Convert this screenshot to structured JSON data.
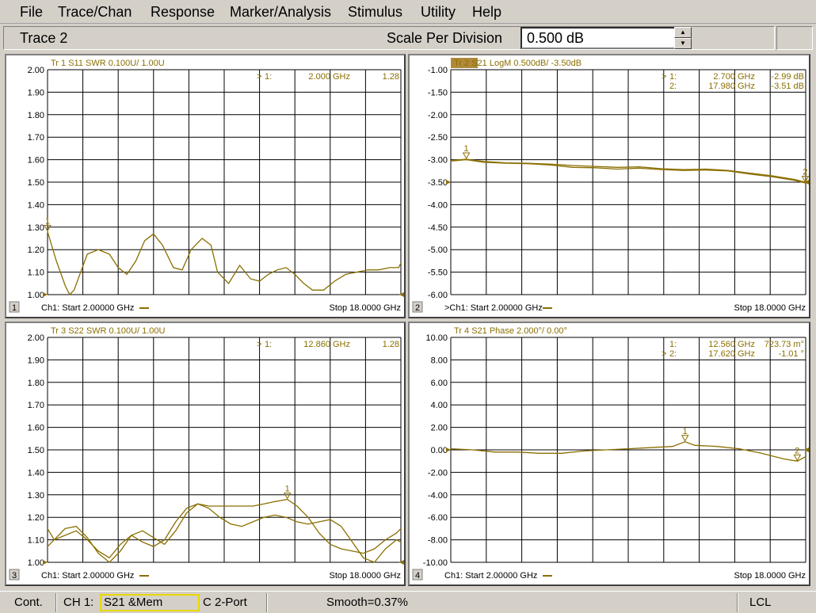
{
  "menu": [
    "File",
    "Trace/Chan",
    "Response",
    "Marker/Analysis",
    "Stimulus",
    "Utility",
    "Help"
  ],
  "entry": {
    "title": "Trace 2",
    "label": "Scale Per Division",
    "value": "0.500 dB"
  },
  "colors": {
    "trace": "#8a6f00",
    "grid": "#000000",
    "active_tab": "#b08a3a"
  },
  "panes": [
    {
      "window_number": "1",
      "header": "Tr  1  S11 SWR 0.100U/  1.00U",
      "active": false,
      "marker_table": [
        {
          "arrow": ">",
          "name": "1:",
          "stimulus": "2.000 GHz",
          "response": "1.28"
        }
      ],
      "footer_start": "Ch1: Start  2.00000 GHz",
      "footer_stop": "Stop  18.0000 GHz",
      "chart_data": {
        "type": "line",
        "xlim": [
          2,
          18
        ],
        "ylim": [
          1.0,
          2.0
        ],
        "yticks": [
          "2.00",
          "1.90",
          "1.80",
          "1.70",
          "1.60",
          "1.50",
          "1.40",
          "1.30",
          "1.20",
          "1.10",
          "1.00"
        ],
        "reference": 1.0,
        "series": [
          {
            "x": [
              2.0,
              2.4,
              2.8,
              3.0,
              3.2,
              3.5,
              3.8,
              4.3,
              4.8,
              5.2,
              5.6,
              6.0,
              6.4,
              6.8,
              7.2,
              7.7,
              8.1,
              8.5,
              9.0,
              9.4,
              9.7,
              10.2,
              10.7,
              11.2,
              11.6,
              12.0,
              12.4,
              12.8,
              13.2,
              13.6,
              14.0,
              14.5,
              15.0,
              15.5,
              16.0,
              16.5,
              17.0,
              17.5,
              17.9,
              18.0
            ],
            "y": [
              1.28,
              1.15,
              1.04,
              1.0,
              1.02,
              1.1,
              1.18,
              1.2,
              1.18,
              1.12,
              1.09,
              1.15,
              1.24,
              1.27,
              1.22,
              1.12,
              1.11,
              1.2,
              1.25,
              1.22,
              1.1,
              1.05,
              1.13,
              1.07,
              1.06,
              1.09,
              1.11,
              1.12,
              1.09,
              1.05,
              1.02,
              1.02,
              1.06,
              1.09,
              1.1,
              1.11,
              1.11,
              1.12,
              1.12,
              1.14
            ]
          }
        ],
        "markers": [
          {
            "label": "1",
            "x": 2.0,
            "y": 1.28
          }
        ]
      }
    },
    {
      "window_number": "2",
      "header": "Tr  2  S21 LogM 0.500dB/  -3.50dB",
      "active": true,
      "marker_table": [
        {
          "arrow": ">",
          "name": "1:",
          "stimulus": "2.700 GHz",
          "response": "-2.99 dB"
        },
        {
          "arrow": "",
          "name": "2:",
          "stimulus": "17.980 GHz",
          "response": "-3.51 dB"
        }
      ],
      "footer_start": ">Ch1: Start  2.00000 GHz",
      "footer_stop": "Stop  18.0000 GHz",
      "chart_data": {
        "type": "line",
        "xlim": [
          2,
          18
        ],
        "ylim": [
          -6.0,
          -1.0
        ],
        "yticks": [
          "-1.00",
          "-1.50",
          "-2.00",
          "-2.50",
          "-3.00",
          "-3.50",
          "-4.00",
          "-4.50",
          "-5.00",
          "-5.50",
          "-6.00"
        ],
        "reference": -3.5,
        "series": [
          {
            "name": "data",
            "x": [
              2.0,
              2.7,
              3.5,
              4.5,
              5.5,
              6.5,
              7.5,
              8.5,
              9.5,
              10.5,
              11.5,
              12.5,
              13.5,
              14.5,
              15.5,
              16.5,
              17.5,
              18.0
            ],
            "y": [
              -3.02,
              -2.99,
              -3.04,
              -3.07,
              -3.08,
              -3.1,
              -3.13,
              -3.15,
              -3.17,
              -3.16,
              -3.2,
              -3.22,
              -3.21,
              -3.24,
              -3.3,
              -3.36,
              -3.44,
              -3.5
            ]
          },
          {
            "name": "memory",
            "x": [
              2.0,
              2.7,
              3.5,
              4.5,
              5.5,
              6.5,
              7.5,
              8.5,
              9.5,
              10.5,
              11.5,
              12.5,
              13.5,
              14.5,
              15.5,
              16.5,
              17.5,
              18.0
            ],
            "y": [
              -3.03,
              -3.0,
              -3.06,
              -3.08,
              -3.09,
              -3.12,
              -3.17,
              -3.18,
              -3.21,
              -3.19,
              -3.22,
              -3.24,
              -3.23,
              -3.25,
              -3.32,
              -3.38,
              -3.46,
              -3.52
            ]
          }
        ],
        "markers": [
          {
            "label": "1",
            "x": 2.7,
            "y": -2.99
          },
          {
            "label": "2",
            "x": 17.98,
            "y": -3.51
          }
        ]
      }
    },
    {
      "window_number": "3",
      "header": "Tr  3  S22 SWR 0.100U/  1.00U",
      "active": false,
      "marker_table": [
        {
          "arrow": ">",
          "name": "1:",
          "stimulus": "12.860 GHz",
          "response": "1.28"
        }
      ],
      "footer_start": "Ch1: Start  2.00000 GHz",
      "footer_stop": "Stop  18.0000 GHz",
      "chart_data": {
        "type": "line",
        "xlim": [
          2,
          18
        ],
        "ylim": [
          1.0,
          2.0
        ],
        "yticks": [
          "2.00",
          "1.90",
          "1.80",
          "1.70",
          "1.60",
          "1.50",
          "1.40",
          "1.30",
          "1.20",
          "1.10",
          "1.00"
        ],
        "reference": 1.0,
        "series": [
          {
            "name": "data",
            "x": [
              2.0,
              2.3,
              2.8,
              3.3,
              3.8,
              4.3,
              4.8,
              5.3,
              5.8,
              6.3,
              6.8,
              7.3,
              7.8,
              8.3,
              8.8,
              9.3,
              9.8,
              10.3,
              10.8,
              11.3,
              11.8,
              12.3,
              12.86,
              13.3,
              13.8,
              14.3,
              14.8,
              15.3,
              15.8,
              16.3,
              16.8,
              17.3,
              17.8,
              18.0
            ],
            "y": [
              1.15,
              1.1,
              1.12,
              1.14,
              1.1,
              1.05,
              1.02,
              1.08,
              1.12,
              1.09,
              1.07,
              1.1,
              1.18,
              1.24,
              1.26,
              1.25,
              1.25,
              1.25,
              1.25,
              1.25,
              1.26,
              1.27,
              1.28,
              1.25,
              1.2,
              1.13,
              1.08,
              1.06,
              1.05,
              1.04,
              1.06,
              1.1,
              1.13,
              1.15
            ]
          },
          {
            "name": "memory",
            "x": [
              2.0,
              2.3,
              2.8,
              3.3,
              3.8,
              4.3,
              4.8,
              5.3,
              5.8,
              6.3,
              6.8,
              7.3,
              7.8,
              8.3,
              8.8,
              9.3,
              9.8,
              10.3,
              10.8,
              11.3,
              11.8,
              12.3,
              12.8,
              13.3,
              13.8,
              14.3,
              14.8,
              15.3,
              15.8,
              16.3,
              16.8,
              17.3,
              17.8,
              18.0
            ],
            "y": [
              1.07,
              1.1,
              1.15,
              1.16,
              1.11,
              1.04,
              1.0,
              1.05,
              1.12,
              1.14,
              1.11,
              1.08,
              1.14,
              1.22,
              1.26,
              1.24,
              1.2,
              1.17,
              1.16,
              1.18,
              1.2,
              1.21,
              1.2,
              1.18,
              1.17,
              1.18,
              1.19,
              1.16,
              1.09,
              1.02,
              1.0,
              1.06,
              1.1,
              1.09
            ]
          }
        ],
        "markers": [
          {
            "label": "1",
            "x": 12.86,
            "y": 1.28
          }
        ]
      }
    },
    {
      "window_number": "4",
      "header": "Tr  4  S21 Phase 2.000°/  0.00°",
      "active": false,
      "marker_table": [
        {
          "arrow": "",
          "name": "1:",
          "stimulus": "12.560 GHz",
          "response": "723.73 m°"
        },
        {
          "arrow": ">",
          "name": "2:",
          "stimulus": "17.620 GHz",
          "response": "-1.01 °"
        }
      ],
      "footer_start": "Ch1: Start  2.00000 GHz",
      "footer_stop": "Stop  18.0000 GHz",
      "chart_data": {
        "type": "line",
        "xlim": [
          2,
          18
        ],
        "ylim": [
          -10.0,
          10.0
        ],
        "yticks": [
          "10.00",
          "8.00",
          "6.00",
          "4.00",
          "2.00",
          "0.00",
          "-2.00",
          "-4.00",
          "-6.00",
          "-8.00",
          "-10.00"
        ],
        "reference": 0.0,
        "series": [
          {
            "x": [
              2.0,
              3.0,
              4.0,
              5.0,
              6.0,
              7.0,
              8.0,
              9.0,
              10.0,
              11.0,
              12.0,
              12.56,
              13.0,
              14.0,
              15.0,
              16.0,
              17.0,
              17.62,
              18.0
            ],
            "y": [
              0.1,
              0.0,
              -0.2,
              -0.2,
              -0.3,
              -0.3,
              -0.1,
              0.0,
              0.1,
              0.2,
              0.3,
              0.72,
              0.4,
              0.3,
              0.1,
              -0.3,
              -0.8,
              -1.01,
              -0.6
            ]
          }
        ],
        "markers": [
          {
            "label": "1",
            "x": 12.56,
            "y": 0.72
          },
          {
            "label": "2",
            "x": 17.62,
            "y": -1.01
          }
        ]
      }
    }
  ],
  "status": {
    "mode": "Cont.",
    "channel": "CH 1:",
    "measurement": "S21 &Mem",
    "cal": "C  2-Port",
    "smoothing": "Smooth=0.37%",
    "remote": "LCL"
  }
}
